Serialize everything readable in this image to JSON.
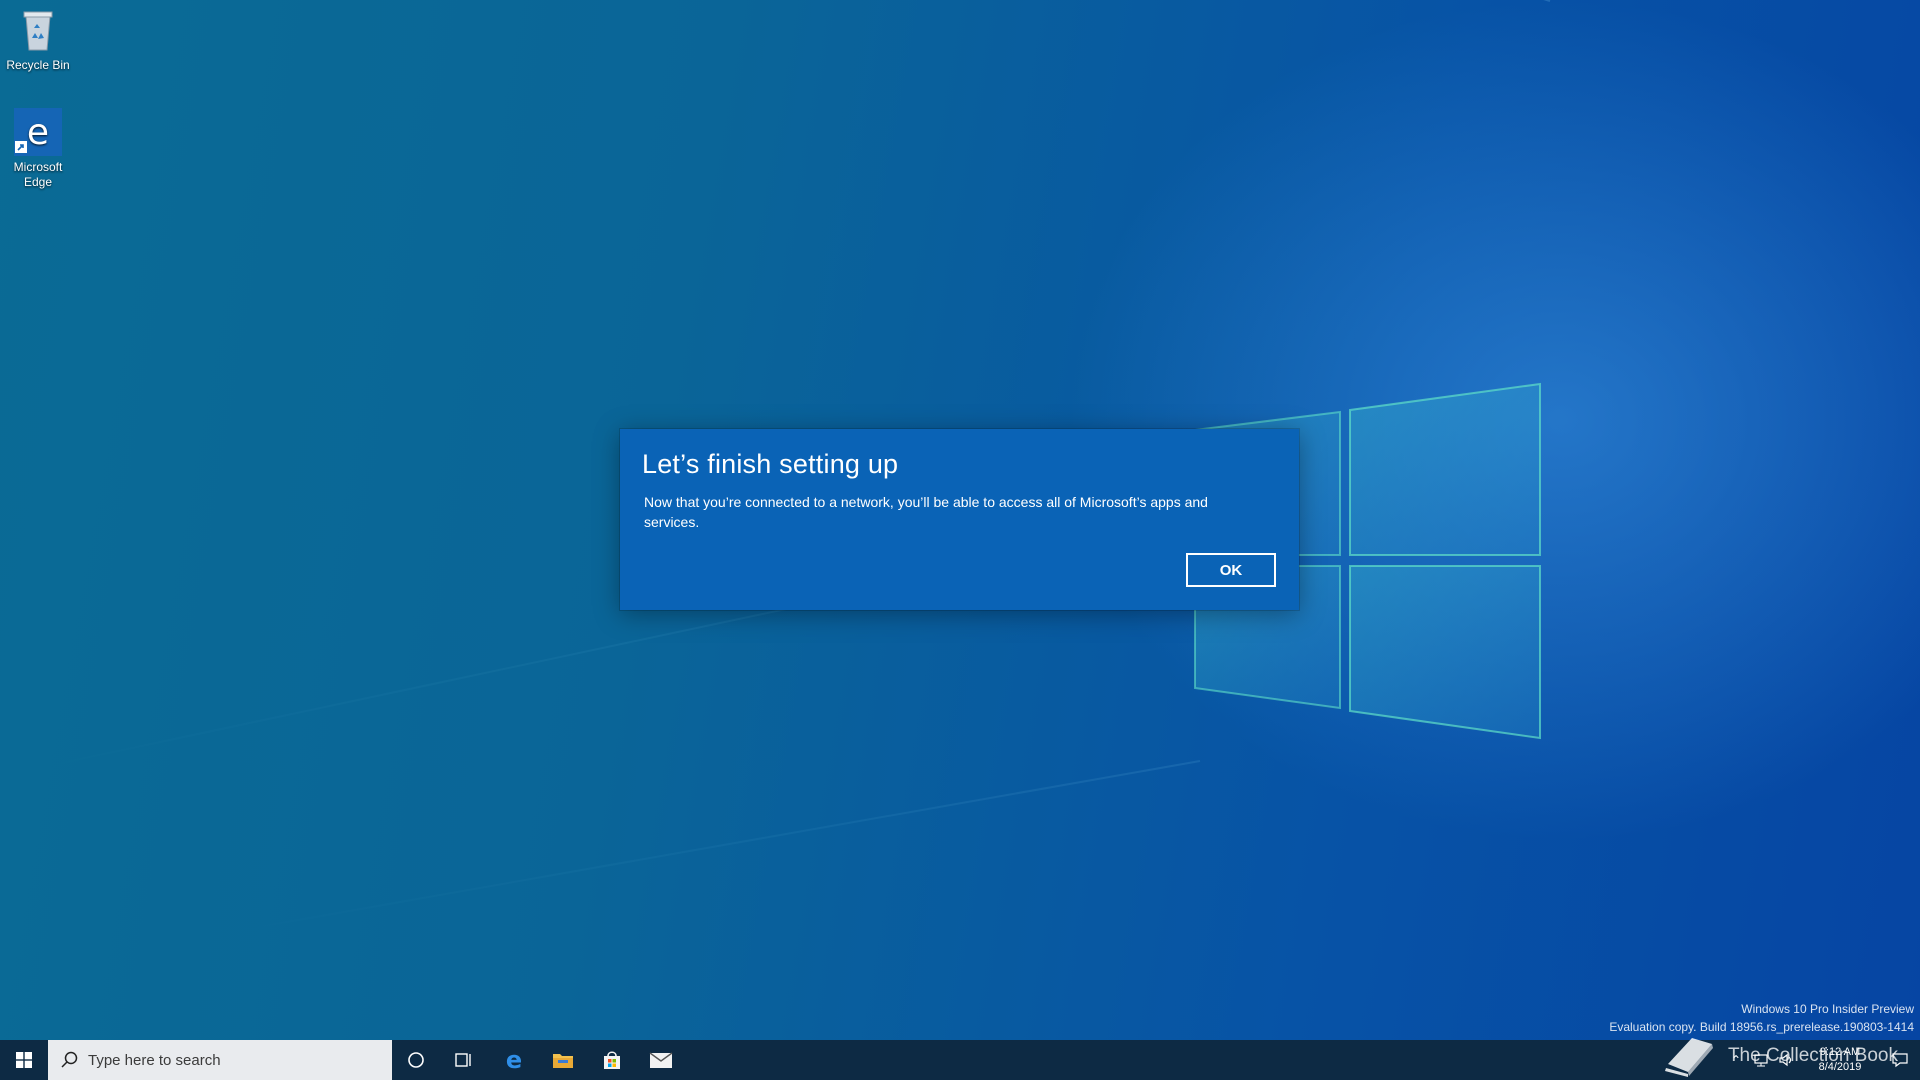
{
  "desktop": {
    "icons": [
      {
        "label": "Recycle Bin",
        "icon": "recycle-bin-icon"
      },
      {
        "label": "Microsoft Edge",
        "icon": "edge-icon"
      }
    ]
  },
  "dialog": {
    "title": "Let’s finish setting up",
    "body": "Now that you’re connected to a network, you’ll be able to access all of Microsoft’s apps and services.",
    "ok_label": "OK",
    "background": "#0a63b6"
  },
  "watermark": {
    "line1": "Windows 10 Pro Insider Preview",
    "line2": "Evaluation copy. Build 18956.rs_prerelease.190803-1414"
  },
  "overlay": {
    "brand": "The Collection Book"
  },
  "taskbar": {
    "search_placeholder": "Type here to search",
    "pinned": [
      "cortana-icon",
      "task-view-icon",
      "edge-icon",
      "file-explorer-icon",
      "store-icon",
      "mail-icon"
    ],
    "clock_time": "9:12 AM",
    "clock_date": "8/4/2019",
    "background": "#0d2a44"
  }
}
